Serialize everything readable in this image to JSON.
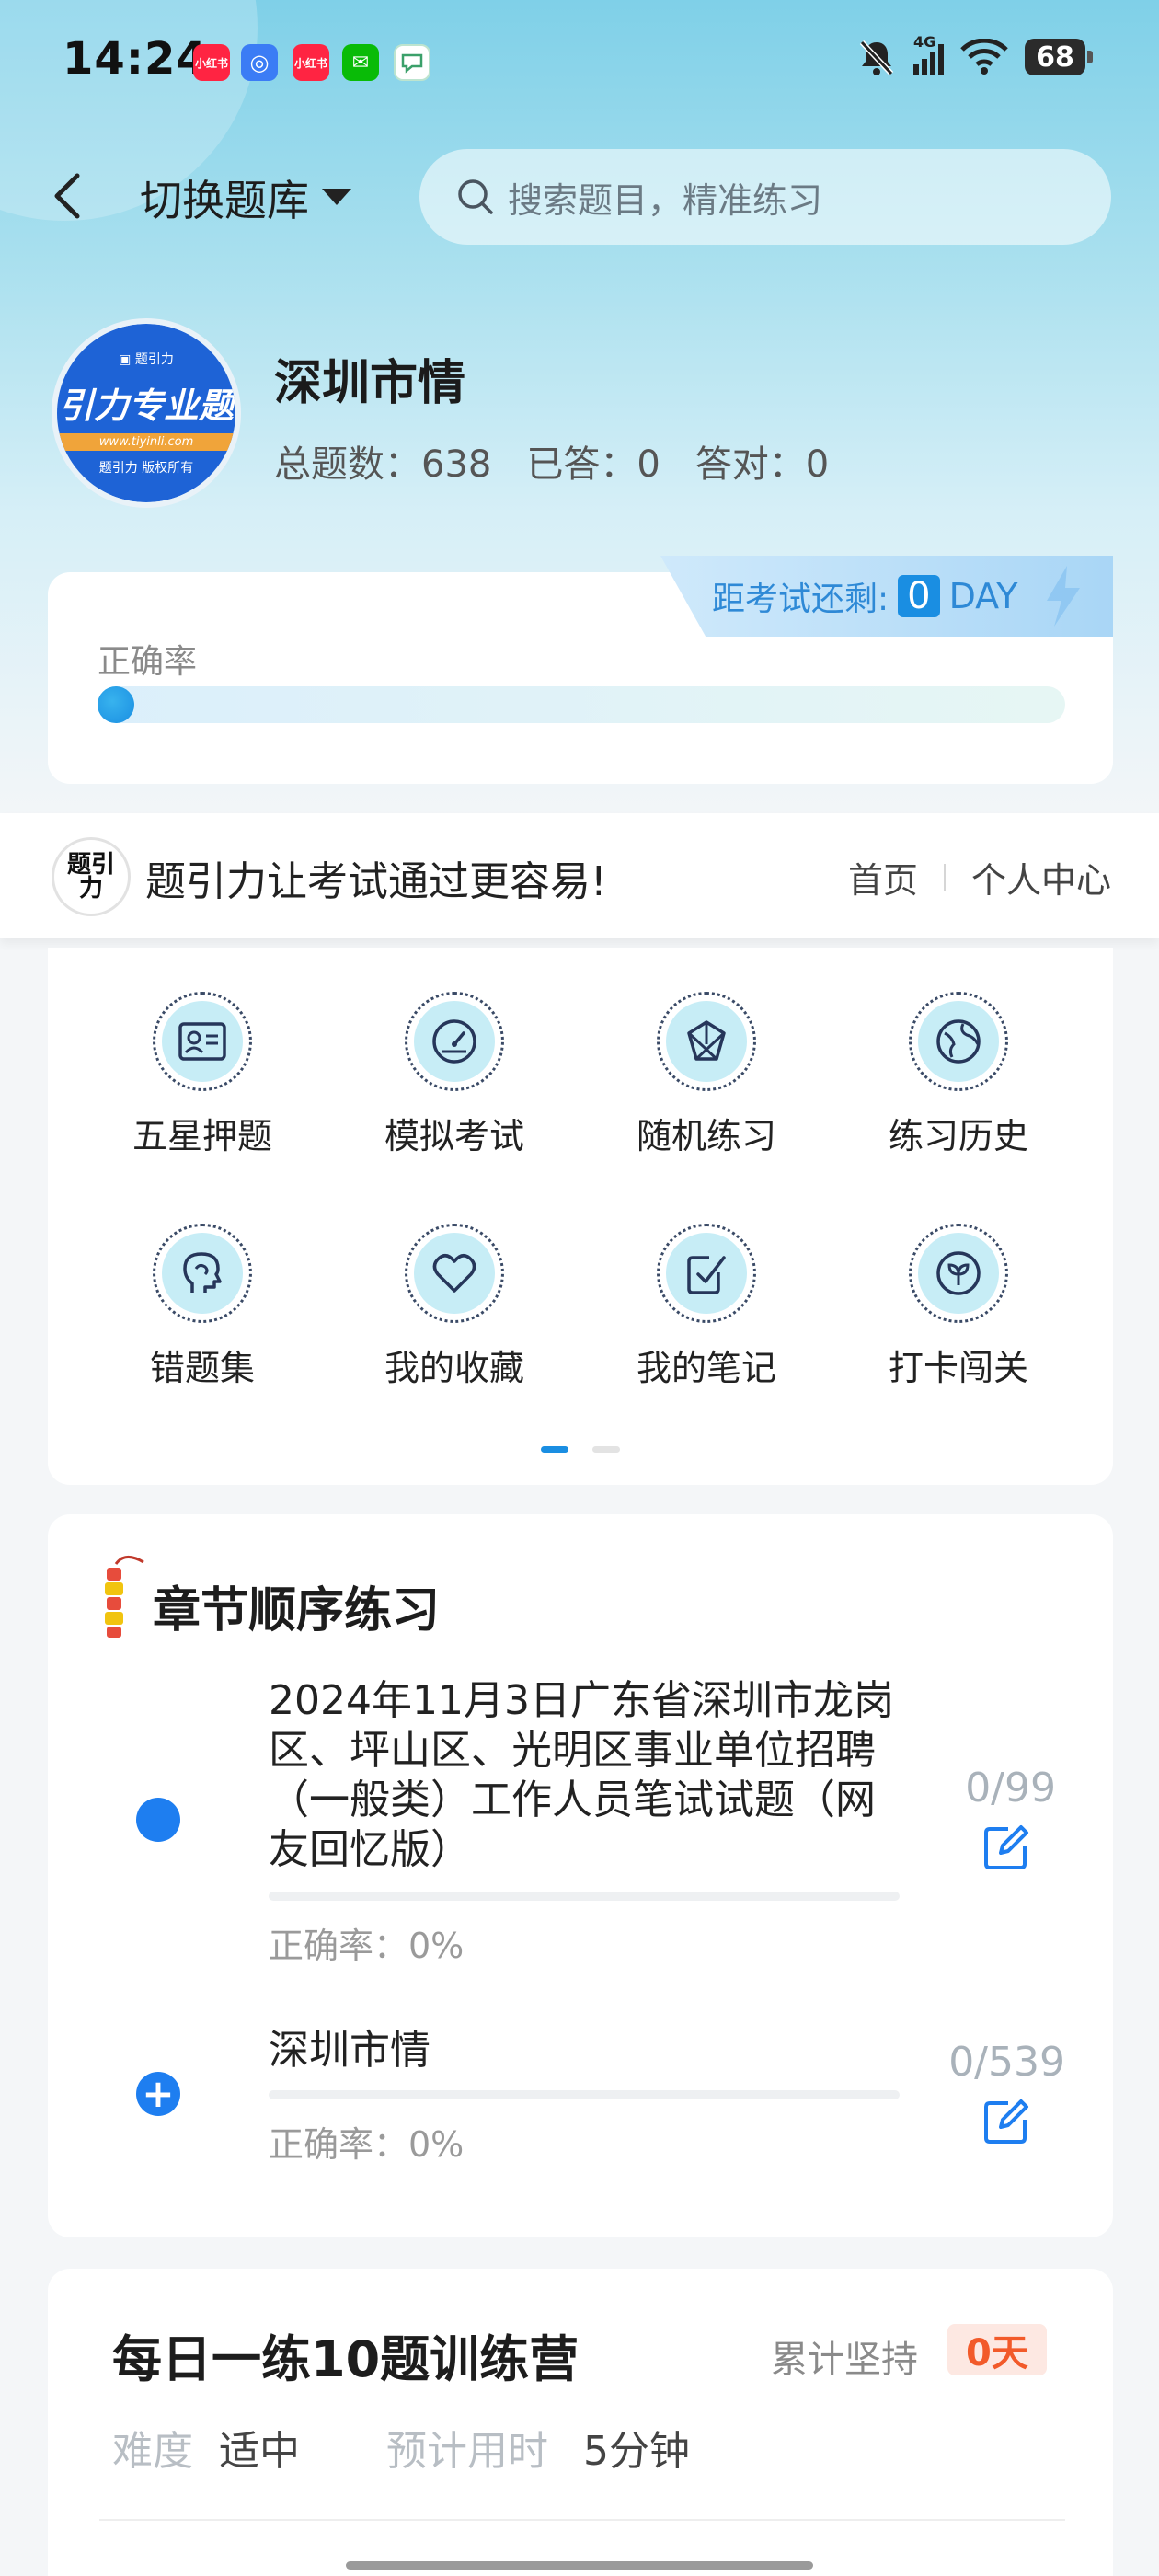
{
  "status_bar": {
    "time": "14:24",
    "apps": [
      {
        "name": "小红书",
        "color": "#ff2442"
      },
      {
        "name": "app-o",
        "color": "#3b7cf5"
      },
      {
        "name": "小红书",
        "color": "#ff2442"
      },
      {
        "name": "wechat",
        "color": "#09bb07"
      },
      {
        "name": "message",
        "color": "#ffffff"
      }
    ],
    "network": "4G",
    "battery": "68"
  },
  "header": {
    "switch_label": "切换题库",
    "search_placeholder": "搜索题目，精准练习"
  },
  "bank": {
    "avatar_brand": "引力专业题",
    "avatar_url": "www.tiyinli.com",
    "avatar_copyright": "题引力 版权所有",
    "title": "深圳市情",
    "stats": {
      "total_label": "总题数：638",
      "answered_label": "已答：0",
      "correct_label": "答对：0"
    }
  },
  "countdown": {
    "label": "距考试还剩:",
    "value": "0",
    "unit": "DAY"
  },
  "accuracy": {
    "label": "正确率",
    "value": 0
  },
  "banner": {
    "logo_text": "题引力",
    "slogan": "题引力让考试通过更容易!",
    "nav": [
      "首页",
      "个人中心"
    ]
  },
  "grid": {
    "items": [
      {
        "label": "五星押题",
        "icon": "id-card-icon"
      },
      {
        "label": "模拟考试",
        "icon": "speedometer-icon"
      },
      {
        "label": "随机练习",
        "icon": "shuffle-icon"
      },
      {
        "label": "练习历史",
        "icon": "globe-icon"
      },
      {
        "label": "错题集",
        "icon": "head-icon"
      },
      {
        "label": "我的收藏",
        "icon": "heart-icon"
      },
      {
        "label": "我的笔记",
        "icon": "note-check-icon"
      },
      {
        "label": "打卡闯关",
        "icon": "leaf-icon"
      }
    ],
    "page": 1,
    "pages": 2
  },
  "chapter": {
    "title": "章节顺序练习",
    "items": [
      {
        "title": "2024年11月3日广东省深圳市龙岗区、坪山区、光明区事业单位招聘（一般类）工作人员笔试试题（网友回忆版）",
        "count": "0/99",
        "accuracy": "正确率：0%"
      },
      {
        "title": "深圳市情",
        "count": "0/539",
        "accuracy": "正确率：0%"
      }
    ]
  },
  "daily": {
    "title": "每日一练10题训练营",
    "persist_label": "累计坚持",
    "persist_value": "0天",
    "difficulty_label": "难度",
    "difficulty_value": "适中",
    "time_label": "预计用时",
    "time_value": "5分钟"
  },
  "colors": {
    "accent": "#1a8ee2",
    "chapter_blue": "#1e7ef0",
    "badge_red": "#f25a2a"
  }
}
